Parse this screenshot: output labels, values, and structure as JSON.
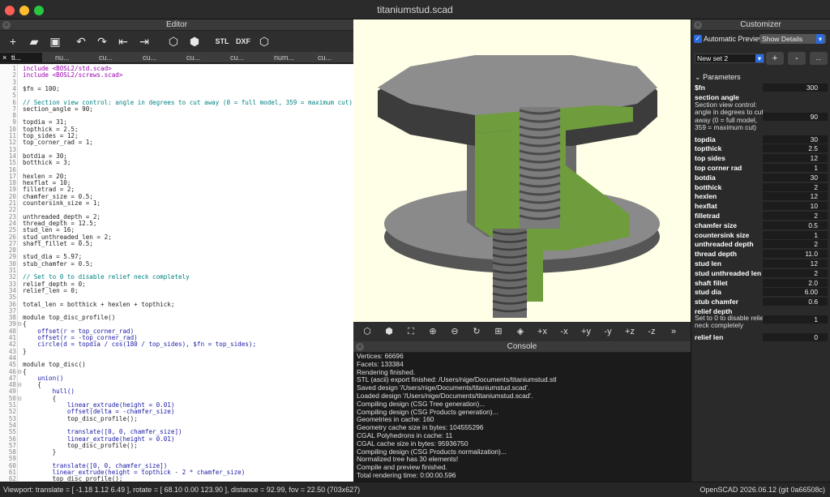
{
  "window": {
    "title": "titaniumstud.scad"
  },
  "colors": {
    "keyword": "#1a1aa6",
    "string": "#a31515",
    "comment": "#008080",
    "number": "#b04000",
    "include": "#9b00b0",
    "model_green": "#6f9c3c",
    "model_grey": "#5f5f5f",
    "viewport_bg": "#fffee6"
  },
  "editor": {
    "title": "Editor",
    "toolbar": [
      {
        "icon": "new-file-icon",
        "glyph": "+"
      },
      {
        "icon": "open-folder-icon",
        "glyph": "▰"
      },
      {
        "icon": "save-icon",
        "glyph": "▣"
      },
      {
        "icon": "undo-icon",
        "glyph": "↶"
      },
      {
        "icon": "redo-icon",
        "glyph": "↷"
      },
      {
        "icon": "unindent-icon",
        "glyph": "⇤"
      },
      {
        "icon": "indent-icon",
        "glyph": "⇥"
      },
      {
        "icon": "preview-icon",
        "glyph": "⬡"
      },
      {
        "icon": "render-icon",
        "glyph": "⬢"
      },
      {
        "icon": "export-stl-icon",
        "glyph": "STL"
      },
      {
        "icon": "export-dxf-icon",
        "glyph": "DXF"
      },
      {
        "icon": "export-3d-icon",
        "glyph": "⬡"
      }
    ],
    "tabs": [
      "ti...",
      "nu...",
      "cu...",
      "cu...",
      "cu...",
      "cu...",
      "num...",
      "cu..."
    ],
    "lines": [
      {
        "n": "1",
        "t": "include <BOSL2/std.scad>",
        "k": "include"
      },
      {
        "n": "2",
        "t": "include <BOSL2/screws.scad>",
        "k": "include"
      },
      {
        "n": "3",
        "t": "",
        "k": "ct"
      },
      {
        "n": "4",
        "t": "$fn = 100;",
        "k": "ct"
      },
      {
        "n": "5",
        "t": "",
        "k": "ct"
      },
      {
        "n": "6",
        "t": "// Section view control: angle in degrees to cut away (0 = full model, 359 = maximum cut)",
        "k": "comment"
      },
      {
        "n": "7",
        "t": "section_angle = 90;",
        "k": "ct"
      },
      {
        "n": "8",
        "t": "",
        "k": "ct"
      },
      {
        "n": "9",
        "t": "topdia = 31;",
        "k": "ct"
      },
      {
        "n": "10",
        "t": "topthick = 2.5;",
        "k": "ct"
      },
      {
        "n": "11",
        "t": "top_sides = 12;",
        "k": "ct"
      },
      {
        "n": "12",
        "t": "top_corner_rad = 1;",
        "k": "ct"
      },
      {
        "n": "13",
        "t": "",
        "k": "ct"
      },
      {
        "n": "14",
        "t": "botdia = 30;",
        "k": "ct"
      },
      {
        "n": "15",
        "t": "botthick = 3;",
        "k": "ct"
      },
      {
        "n": "16",
        "t": "",
        "k": "ct"
      },
      {
        "n": "17",
        "t": "hexlen = 20;",
        "k": "ct"
      },
      {
        "n": "18",
        "t": "hexflat = 10;",
        "k": "ct"
      },
      {
        "n": "19",
        "t": "filletrad = 2;",
        "k": "ct"
      },
      {
        "n": "20",
        "t": "chamfer_size = 0.5;",
        "k": "ct"
      },
      {
        "n": "21",
        "t": "countersink_size = 1;",
        "k": "ct"
      },
      {
        "n": "22",
        "t": "",
        "k": "ct"
      },
      {
        "n": "23",
        "t": "unthreaded_depth = 2;",
        "k": "ct"
      },
      {
        "n": "24",
        "t": "thread_depth = 12.5;",
        "k": "ct"
      },
      {
        "n": "25",
        "t": "stud_len = 16;",
        "k": "ct"
      },
      {
        "n": "26",
        "t": "stud_unthreaded_len = 2;",
        "k": "ct"
      },
      {
        "n": "27",
        "t": "shaft_fillet = 0.5;",
        "k": "ct"
      },
      {
        "n": "28",
        "t": "",
        "k": "ct"
      },
      {
        "n": "29",
        "t": "stud_dia = 5.97;",
        "k": "ct"
      },
      {
        "n": "30",
        "t": "stub_chamfer = 0.5;",
        "k": "ct"
      },
      {
        "n": "31",
        "t": "",
        "k": "ct"
      },
      {
        "n": "32",
        "t": "// Set to 0 to disable relief neck completely",
        "k": "comment"
      },
      {
        "n": "33",
        "t": "relief_depth = 0;",
        "k": "ct"
      },
      {
        "n": "34",
        "t": "relief_len = 0;",
        "k": "ct"
      },
      {
        "n": "35",
        "t": "",
        "k": "ct"
      },
      {
        "n": "36",
        "t": "total_len = botthick + hexlen + topthick;",
        "k": "ct"
      },
      {
        "n": "37",
        "t": "",
        "k": "ct"
      },
      {
        "n": "38",
        "t": "module top_disc_profile()",
        "k": "ct"
      },
      {
        "n": "39",
        "t": "{",
        "k": "ct",
        "f": "⊟"
      },
      {
        "n": "40",
        "t": "    offset(r = top_corner_rad)",
        "k": "keyword"
      },
      {
        "n": "41",
        "t": "    offset(r = -top_corner_rad)",
        "k": "keyword"
      },
      {
        "n": "42",
        "t": "    circle(d = topdia / cos(180 / top_sides), $fn = top_sides);",
        "k": "keyword"
      },
      {
        "n": "43",
        "t": "}",
        "k": "ct"
      },
      {
        "n": "44",
        "t": "",
        "k": "ct"
      },
      {
        "n": "45",
        "t": "module top_disc()",
        "k": "ct"
      },
      {
        "n": "46",
        "t": "{",
        "k": "ct",
        "f": "⊟"
      },
      {
        "n": "47",
        "t": "    union()",
        "k": "keyword"
      },
      {
        "n": "48",
        "t": "    {",
        "k": "ct",
        "f": "⊟"
      },
      {
        "n": "49",
        "t": "        hull()",
        "k": "keyword"
      },
      {
        "n": "50",
        "t": "        {",
        "k": "ct",
        "f": "⊟"
      },
      {
        "n": "51",
        "t": "            linear_extrude(height = 0.01)",
        "k": "keyword"
      },
      {
        "n": "52",
        "t": "            offset(delta = -chamfer_size)",
        "k": "keyword"
      },
      {
        "n": "53",
        "t": "            top_disc_profile();",
        "k": "ct"
      },
      {
        "n": "54",
        "t": "",
        "k": "ct"
      },
      {
        "n": "55",
        "t": "            translate([0, 0, chamfer_size])",
        "k": "keyword"
      },
      {
        "n": "56",
        "t": "            linear_extrude(height = 0.01)",
        "k": "keyword"
      },
      {
        "n": "57",
        "t": "            top_disc_profile();",
        "k": "ct"
      },
      {
        "n": "58",
        "t": "        }",
        "k": "ct"
      },
      {
        "n": "59",
        "t": "",
        "k": "ct"
      },
      {
        "n": "60",
        "t": "        translate([0, 0, chamfer_size])",
        "k": "keyword"
      },
      {
        "n": "61",
        "t": "        linear_extrude(height = topthick - 2 * chamfer_size)",
        "k": "keyword"
      },
      {
        "n": "62",
        "t": "        top_disc_profile();",
        "k": "ct"
      }
    ]
  },
  "viewport_toolbar": [
    {
      "icon": "preview-icon",
      "glyph": "⬡"
    },
    {
      "icon": "render-icon",
      "glyph": "⬢"
    },
    {
      "icon": "view-all-icon",
      "glyph": "⛶"
    },
    {
      "icon": "zoom-in-icon",
      "glyph": "⊕"
    },
    {
      "icon": "zoom-out-icon",
      "glyph": "⊖"
    },
    {
      "icon": "reset-view-icon",
      "glyph": "↻"
    },
    {
      "icon": "perspective-icon",
      "glyph": "⊞"
    },
    {
      "icon": "orthogonal-icon",
      "glyph": "◈"
    },
    {
      "icon": "view-right-icon",
      "glyph": "+x"
    },
    {
      "icon": "view-left-icon",
      "glyph": "-x"
    },
    {
      "icon": "view-back-icon",
      "glyph": "+y"
    },
    {
      "icon": "view-front-icon",
      "glyph": "-y"
    },
    {
      "icon": "view-top-icon",
      "glyph": "+z"
    },
    {
      "icon": "view-bottom-icon",
      "glyph": "-z"
    },
    {
      "icon": "more-icon",
      "glyph": "»"
    }
  ],
  "console": {
    "title": "Console",
    "lines": [
      "    Vertices:  66696",
      "    Facets:    133384",
      "Rendering finished.",
      "STL (ascii) export finished: /Users/nige/Documents/titaniumstud.stl",
      "Saved design '/Users/nige/Documents/titaniumstud.scad'.",
      "Loaded design '/Users/nige/Documents/titaniumstud.scad'.",
      "Compiling design (CSG Tree generation)...",
      "Compiling design (CSG Products generation)...",
      "Geometries in cache: 160",
      "Geometry cache size in bytes: 104555296",
      "CGAL Polyhedrons in cache: 11",
      "CGAL cache size in bytes: 95936750",
      "Compiling design (CSG Products normalization)...",
      "Normalized tree has 30 elements!",
      "Compile and preview finished.",
      "Total rendering time: 0:00:00.596"
    ]
  },
  "customizer": {
    "title": "Customizer",
    "auto_preview": "Automatic Preview",
    "show_details": "Show Details",
    "preset": "New set 2",
    "add_btn": "+",
    "remove_btn": "-",
    "more_btn": "...",
    "section": "Parameters",
    "params": [
      {
        "label": "$fn",
        "value": "300"
      },
      {
        "label": "section angle",
        "value": null
      },
      {
        "label": "topdia",
        "value": "30"
      },
      {
        "label": "topthick",
        "value": "2.5"
      },
      {
        "label": "top sides",
        "value": "12"
      },
      {
        "label": "top corner rad",
        "value": "1"
      },
      {
        "label": "botdia",
        "value": "30"
      },
      {
        "label": "botthick",
        "value": "2"
      },
      {
        "label": "hexlen",
        "value": "12"
      },
      {
        "label": "hexflat",
        "value": "10"
      },
      {
        "label": "filletrad",
        "value": "2"
      },
      {
        "label": "chamfer size",
        "value": "0.5"
      },
      {
        "label": "countersink size",
        "value": "1"
      },
      {
        "label": "unthreaded depth",
        "value": "2"
      },
      {
        "label": "thread depth",
        "value": "11.0"
      },
      {
        "label": "stud len",
        "value": "12"
      },
      {
        "label": "stud unthreaded len",
        "value": "2"
      },
      {
        "label": "shaft fillet",
        "value": "2.0"
      },
      {
        "label": "stud dia",
        "value": "6.00"
      },
      {
        "label": "stub chamfer",
        "value": "0.6"
      },
      {
        "label": "relief depth",
        "value": null
      },
      {
        "label": "relief len",
        "value": "0"
      }
    ],
    "section_angle_desc": "Section view control: angle in degrees to cut away (0 = full model, 359 = maximum cut)",
    "section_angle_value": "90",
    "relief_depth_desc": "Set to 0 to disable relief neck completely",
    "relief_depth_value": "1"
  },
  "status": {
    "viewport": "Viewport: translate = [ -1.18 1.12 6.49 ], rotate = [ 68.10 0.00 123.90 ], distance = 92.99, fov = 22.50 (703x627)",
    "version": "OpenSCAD 2026.06.12 (git 0a66508c)"
  }
}
